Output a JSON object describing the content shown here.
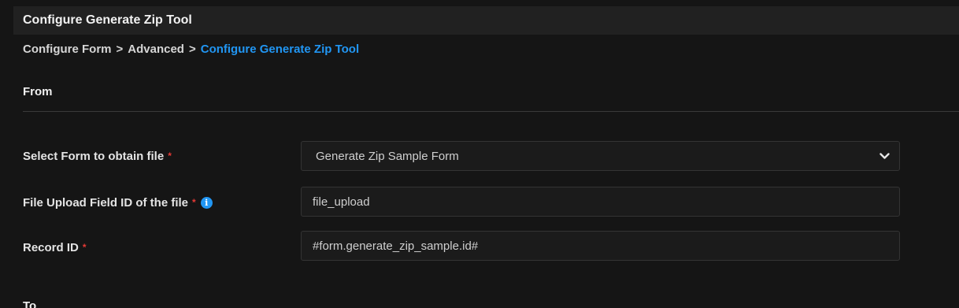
{
  "header": {
    "title": "Configure Generate Zip Tool"
  },
  "breadcrumb": {
    "items": [
      "Configure Form",
      "Advanced"
    ],
    "separator": ">",
    "current": "Configure Generate Zip Tool"
  },
  "sections": {
    "from": "From",
    "to": "To"
  },
  "form": {
    "select_form": {
      "label": "Select Form to obtain file",
      "required_mark": "*",
      "value": "Generate Zip Sample Form"
    },
    "file_upload_field": {
      "label": "File Upload Field ID of the file",
      "required_mark": "*",
      "info_icon": "i",
      "value": "file_upload"
    },
    "record_id": {
      "label": "Record ID",
      "required_mark": "*",
      "value": "#form.generate_zip_sample.id#"
    }
  },
  "colors": {
    "accent": "#2196f3",
    "required": "#e53935",
    "background": "#151515"
  }
}
